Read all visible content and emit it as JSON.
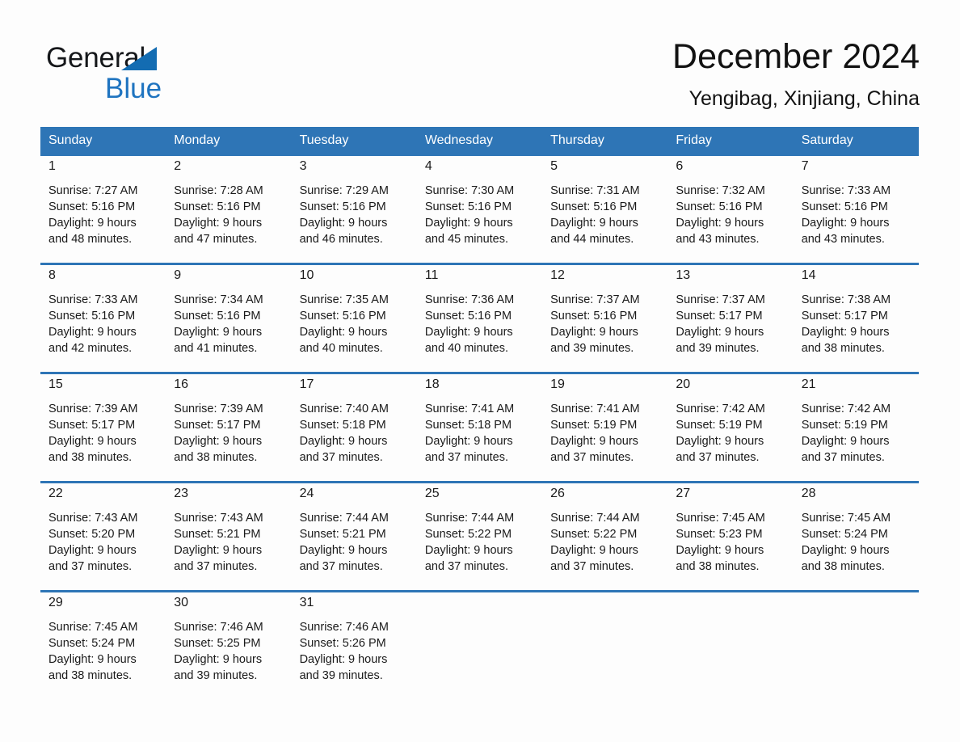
{
  "brand": {
    "name_part1": "General",
    "name_part2": "Blue",
    "triangle_color": "#136cb2",
    "blue_text_color": "#1f74c0"
  },
  "header": {
    "title": "December 2024",
    "subtitle": "Yengibag, Xinjiang, China"
  },
  "theme": {
    "header_blue": "#2e75b6",
    "daynum_band": "#f0f0f0",
    "page_background": "#fdfdfd",
    "text": "#1a1a1a"
  },
  "weekdays": [
    "Sunday",
    "Monday",
    "Tuesday",
    "Wednesday",
    "Thursday",
    "Friday",
    "Saturday"
  ],
  "weeks": [
    {
      "days": [
        {
          "date": "1",
          "sunrise": "Sunrise: 7:27 AM",
          "sunset": "Sunset: 5:16 PM",
          "daylight_line1": "Daylight: 9 hours",
          "daylight_line2": "and 48 minutes."
        },
        {
          "date": "2",
          "sunrise": "Sunrise: 7:28 AM",
          "sunset": "Sunset: 5:16 PM",
          "daylight_line1": "Daylight: 9 hours",
          "daylight_line2": "and 47 minutes."
        },
        {
          "date": "3",
          "sunrise": "Sunrise: 7:29 AM",
          "sunset": "Sunset: 5:16 PM",
          "daylight_line1": "Daylight: 9 hours",
          "daylight_line2": "and 46 minutes."
        },
        {
          "date": "4",
          "sunrise": "Sunrise: 7:30 AM",
          "sunset": "Sunset: 5:16 PM",
          "daylight_line1": "Daylight: 9 hours",
          "daylight_line2": "and 45 minutes."
        },
        {
          "date": "5",
          "sunrise": "Sunrise: 7:31 AM",
          "sunset": "Sunset: 5:16 PM",
          "daylight_line1": "Daylight: 9 hours",
          "daylight_line2": "and 44 minutes."
        },
        {
          "date": "6",
          "sunrise": "Sunrise: 7:32 AM",
          "sunset": "Sunset: 5:16 PM",
          "daylight_line1": "Daylight: 9 hours",
          "daylight_line2": "and 43 minutes."
        },
        {
          "date": "7",
          "sunrise": "Sunrise: 7:33 AM",
          "sunset": "Sunset: 5:16 PM",
          "daylight_line1": "Daylight: 9 hours",
          "daylight_line2": "and 43 minutes."
        }
      ]
    },
    {
      "days": [
        {
          "date": "8",
          "sunrise": "Sunrise: 7:33 AM",
          "sunset": "Sunset: 5:16 PM",
          "daylight_line1": "Daylight: 9 hours",
          "daylight_line2": "and 42 minutes."
        },
        {
          "date": "9",
          "sunrise": "Sunrise: 7:34 AM",
          "sunset": "Sunset: 5:16 PM",
          "daylight_line1": "Daylight: 9 hours",
          "daylight_line2": "and 41 minutes."
        },
        {
          "date": "10",
          "sunrise": "Sunrise: 7:35 AM",
          "sunset": "Sunset: 5:16 PM",
          "daylight_line1": "Daylight: 9 hours",
          "daylight_line2": "and 40 minutes."
        },
        {
          "date": "11",
          "sunrise": "Sunrise: 7:36 AM",
          "sunset": "Sunset: 5:16 PM",
          "daylight_line1": "Daylight: 9 hours",
          "daylight_line2": "and 40 minutes."
        },
        {
          "date": "12",
          "sunrise": "Sunrise: 7:37 AM",
          "sunset": "Sunset: 5:16 PM",
          "daylight_line1": "Daylight: 9 hours",
          "daylight_line2": "and 39 minutes."
        },
        {
          "date": "13",
          "sunrise": "Sunrise: 7:37 AM",
          "sunset": "Sunset: 5:17 PM",
          "daylight_line1": "Daylight: 9 hours",
          "daylight_line2": "and 39 minutes."
        },
        {
          "date": "14",
          "sunrise": "Sunrise: 7:38 AM",
          "sunset": "Sunset: 5:17 PM",
          "daylight_line1": "Daylight: 9 hours",
          "daylight_line2": "and 38 minutes."
        }
      ]
    },
    {
      "days": [
        {
          "date": "15",
          "sunrise": "Sunrise: 7:39 AM",
          "sunset": "Sunset: 5:17 PM",
          "daylight_line1": "Daylight: 9 hours",
          "daylight_line2": "and 38 minutes."
        },
        {
          "date": "16",
          "sunrise": "Sunrise: 7:39 AM",
          "sunset": "Sunset: 5:17 PM",
          "daylight_line1": "Daylight: 9 hours",
          "daylight_line2": "and 38 minutes."
        },
        {
          "date": "17",
          "sunrise": "Sunrise: 7:40 AM",
          "sunset": "Sunset: 5:18 PM",
          "daylight_line1": "Daylight: 9 hours",
          "daylight_line2": "and 37 minutes."
        },
        {
          "date": "18",
          "sunrise": "Sunrise: 7:41 AM",
          "sunset": "Sunset: 5:18 PM",
          "daylight_line1": "Daylight: 9 hours",
          "daylight_line2": "and 37 minutes."
        },
        {
          "date": "19",
          "sunrise": "Sunrise: 7:41 AM",
          "sunset": "Sunset: 5:19 PM",
          "daylight_line1": "Daylight: 9 hours",
          "daylight_line2": "and 37 minutes."
        },
        {
          "date": "20",
          "sunrise": "Sunrise: 7:42 AM",
          "sunset": "Sunset: 5:19 PM",
          "daylight_line1": "Daylight: 9 hours",
          "daylight_line2": "and 37 minutes."
        },
        {
          "date": "21",
          "sunrise": "Sunrise: 7:42 AM",
          "sunset": "Sunset: 5:19 PM",
          "daylight_line1": "Daylight: 9 hours",
          "daylight_line2": "and 37 minutes."
        }
      ]
    },
    {
      "days": [
        {
          "date": "22",
          "sunrise": "Sunrise: 7:43 AM",
          "sunset": "Sunset: 5:20 PM",
          "daylight_line1": "Daylight: 9 hours",
          "daylight_line2": "and 37 minutes."
        },
        {
          "date": "23",
          "sunrise": "Sunrise: 7:43 AM",
          "sunset": "Sunset: 5:21 PM",
          "daylight_line1": "Daylight: 9 hours",
          "daylight_line2": "and 37 minutes."
        },
        {
          "date": "24",
          "sunrise": "Sunrise: 7:44 AM",
          "sunset": "Sunset: 5:21 PM",
          "daylight_line1": "Daylight: 9 hours",
          "daylight_line2": "and 37 minutes."
        },
        {
          "date": "25",
          "sunrise": "Sunrise: 7:44 AM",
          "sunset": "Sunset: 5:22 PM",
          "daylight_line1": "Daylight: 9 hours",
          "daylight_line2": "and 37 minutes."
        },
        {
          "date": "26",
          "sunrise": "Sunrise: 7:44 AM",
          "sunset": "Sunset: 5:22 PM",
          "daylight_line1": "Daylight: 9 hours",
          "daylight_line2": "and 37 minutes."
        },
        {
          "date": "27",
          "sunrise": "Sunrise: 7:45 AM",
          "sunset": "Sunset: 5:23 PM",
          "daylight_line1": "Daylight: 9 hours",
          "daylight_line2": "and 38 minutes."
        },
        {
          "date": "28",
          "sunrise": "Sunrise: 7:45 AM",
          "sunset": "Sunset: 5:24 PM",
          "daylight_line1": "Daylight: 9 hours",
          "daylight_line2": "and 38 minutes."
        }
      ]
    },
    {
      "days": [
        {
          "date": "29",
          "sunrise": "Sunrise: 7:45 AM",
          "sunset": "Sunset: 5:24 PM",
          "daylight_line1": "Daylight: 9 hours",
          "daylight_line2": "and 38 minutes."
        },
        {
          "date": "30",
          "sunrise": "Sunrise: 7:46 AM",
          "sunset": "Sunset: 5:25 PM",
          "daylight_line1": "Daylight: 9 hours",
          "daylight_line2": "and 39 minutes."
        },
        {
          "date": "31",
          "sunrise": "Sunrise: 7:46 AM",
          "sunset": "Sunset: 5:26 PM",
          "daylight_line1": "Daylight: 9 hours",
          "daylight_line2": "and 39 minutes."
        },
        {
          "date": "",
          "sunrise": "",
          "sunset": "",
          "daylight_line1": "",
          "daylight_line2": ""
        },
        {
          "date": "",
          "sunrise": "",
          "sunset": "",
          "daylight_line1": "",
          "daylight_line2": ""
        },
        {
          "date": "",
          "sunrise": "",
          "sunset": "",
          "daylight_line1": "",
          "daylight_line2": ""
        },
        {
          "date": "",
          "sunrise": "",
          "sunset": "",
          "daylight_line1": "",
          "daylight_line2": ""
        }
      ]
    }
  ]
}
